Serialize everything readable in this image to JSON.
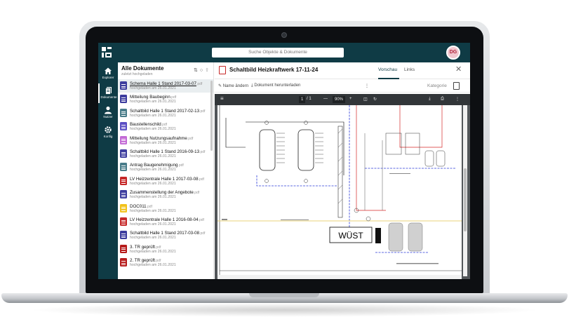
{
  "app": {
    "search_placeholder": "Suche Objekte & Dokumente",
    "avatar_initials": "DG",
    "brand_color": "#0f3b45"
  },
  "nav": {
    "items": [
      {
        "label": "Explorer",
        "icon": "home-icon"
      },
      {
        "label": "Dokumente",
        "icon": "documents-icon"
      },
      {
        "label": "Nutzer",
        "icon": "user-icon"
      },
      {
        "label": "Konfig",
        "icon": "gear-icon"
      }
    ]
  },
  "doclist": {
    "title": "Alle Dokumente",
    "subtitle": "zuletzt hochgeladen",
    "items": [
      {
        "name": "Schema Halle 1 Stand 2017-03-07",
        "ext": ".pdf",
        "date": "hochgeladen am 26.01.2021",
        "color": "#3d3d9e"
      },
      {
        "name": "Mitteilung Baubeginn",
        "ext": ".pdf",
        "date": "hochgeladen am 26.01.2021",
        "color": "#3d3d9e"
      },
      {
        "name": "Schaltbild Halle 1 Stand 2017-02-13",
        "ext": ".pdf",
        "date": "hochgeladen am 26.01.2021",
        "color": "#4a7d8a"
      },
      {
        "name": "Baustellenschild",
        "ext": ".pdf",
        "date": "hochgeladen am 26.01.2021",
        "color": "#5b4fc4"
      },
      {
        "name": "Mitteilung Nutzungsaufnahme",
        "ext": ".pdf",
        "date": "hochgeladen am 26.01.2021",
        "color": "#c36bd6"
      },
      {
        "name": "Schaltbild Halle 1 Stand 2016-09-13",
        "ext": ".pdf",
        "date": "hochgeladen am 26.01.2021",
        "color": "#3d3d9e"
      },
      {
        "name": "Antrag Baugenehmigung",
        "ext": ".pdf",
        "date": "hochgeladen am 26.01.2021",
        "color": "#4a7d8a"
      },
      {
        "name": "LV Heizzentrale Halle 1 2017-03-08",
        "ext": ".pdf",
        "date": "hochgeladen am 26.01.2021",
        "color": "#c62828"
      },
      {
        "name": "Zusammenstellung der Angebote",
        "ext": ".pdf",
        "date": "hochgeladen am 26.01.2021",
        "color": "#3d3d9e"
      },
      {
        "name": "DOC011",
        "ext": ".pdf",
        "date": "hochgeladen am 26.01.2021",
        "color": "#f2c21b"
      },
      {
        "name": "LV Heizzentrale Halle 1 2016-08-04",
        "ext": ".pdf",
        "date": "hochgeladen am 26.01.2021",
        "color": "#c62828"
      },
      {
        "name": "Schaltbild Halle 1 Stand 2017-03-08",
        "ext": ".pdf",
        "date": "hochgeladen am 26.01.2021",
        "color": "#3d3d9e"
      },
      {
        "name": "3. TR geprüft",
        "ext": ".pdf",
        "date": "hochgeladen am 26.01.2021",
        "color": "#b71c1c"
      },
      {
        "name": "2. TR geprüft",
        "ext": ".pdf",
        "date": "hochgeladen am 26.01.2021",
        "color": "#b71c1c"
      }
    ]
  },
  "detail": {
    "title": "Schaltbild Heizkraftwerk 17-11-24",
    "tabs": [
      "Vorschau",
      "Links"
    ],
    "close": "✕",
    "tools": {
      "rename": "Name ändern",
      "download": "Dokument herunterladen",
      "more": "⋮",
      "category": "Kategorie"
    }
  },
  "viewer": {
    "page_current": "1",
    "page_total": "/ 1",
    "zoom": "90%",
    "drawing_label": "WÜST"
  }
}
